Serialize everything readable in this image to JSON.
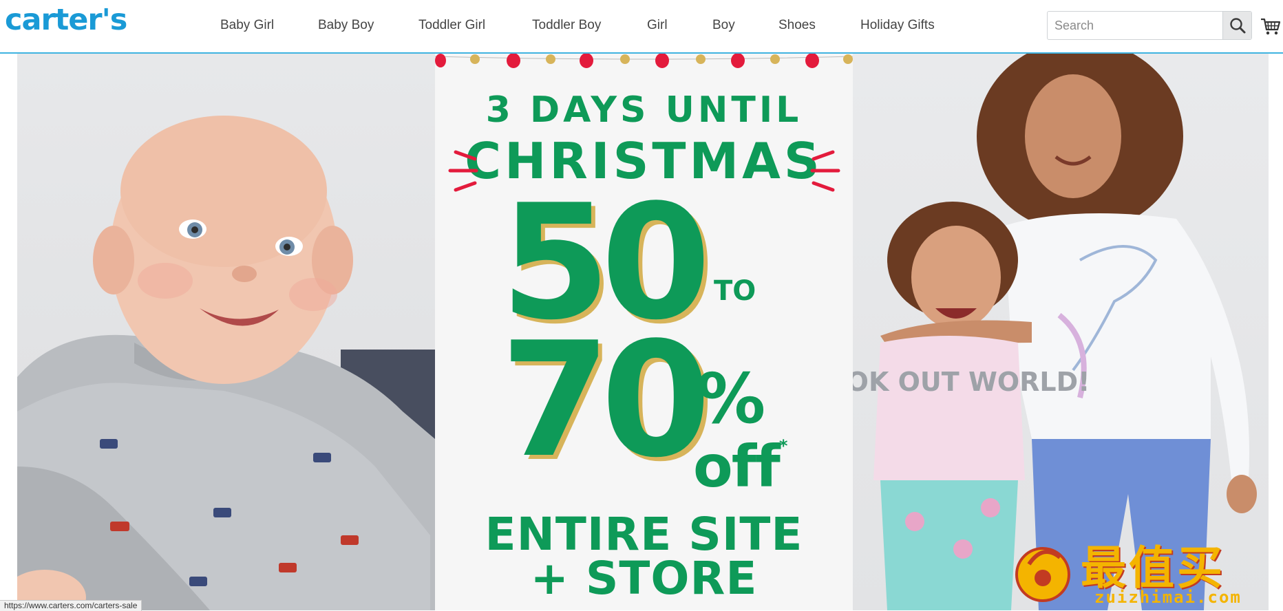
{
  "header": {
    "logo_text": "carter's",
    "nav": [
      {
        "label": "Baby Girl"
      },
      {
        "label": "Baby Boy"
      },
      {
        "label": "Toddler Girl"
      },
      {
        "label": "Toddler Boy"
      },
      {
        "label": "Girl"
      },
      {
        "label": "Boy"
      },
      {
        "label": "Shoes"
      },
      {
        "label": "Holiday Gifts"
      }
    ],
    "search": {
      "placeholder": "Search",
      "value": "",
      "icon": "search-icon"
    },
    "cart": {
      "icon": "cart-icon"
    }
  },
  "hero": {
    "countdown_line1": "3 DAYS UNTIL",
    "countdown_line2": "CHRISTMAS",
    "discount_from": "50",
    "discount_to_word": "TO",
    "discount_to": "70",
    "percent_sign": "%",
    "off_text": "off",
    "asterisk": "*",
    "scope_line1": "ENTIRE SITE",
    "scope_line2": "+ STORE",
    "left_panel_image": "smiling baby in gray sweatshirt",
    "right_panel_image": "two smiling girls in unicorn and LOOK OUT WORLD tops",
    "right_panel_shirt_text": "LOOK OUT WORLD!"
  },
  "status_bar": {
    "url": "https://www.carters.com/carters-sale"
  },
  "watermark": {
    "cn_text": "最值买",
    "en_text": "zuizhimai.com"
  },
  "colors": {
    "brand_blue": "#1a9ad6",
    "promo_green": "#0e9a58",
    "accent_red": "#e31b3c",
    "gold": "#d7b45a",
    "header_border": "#3fb3e0"
  }
}
